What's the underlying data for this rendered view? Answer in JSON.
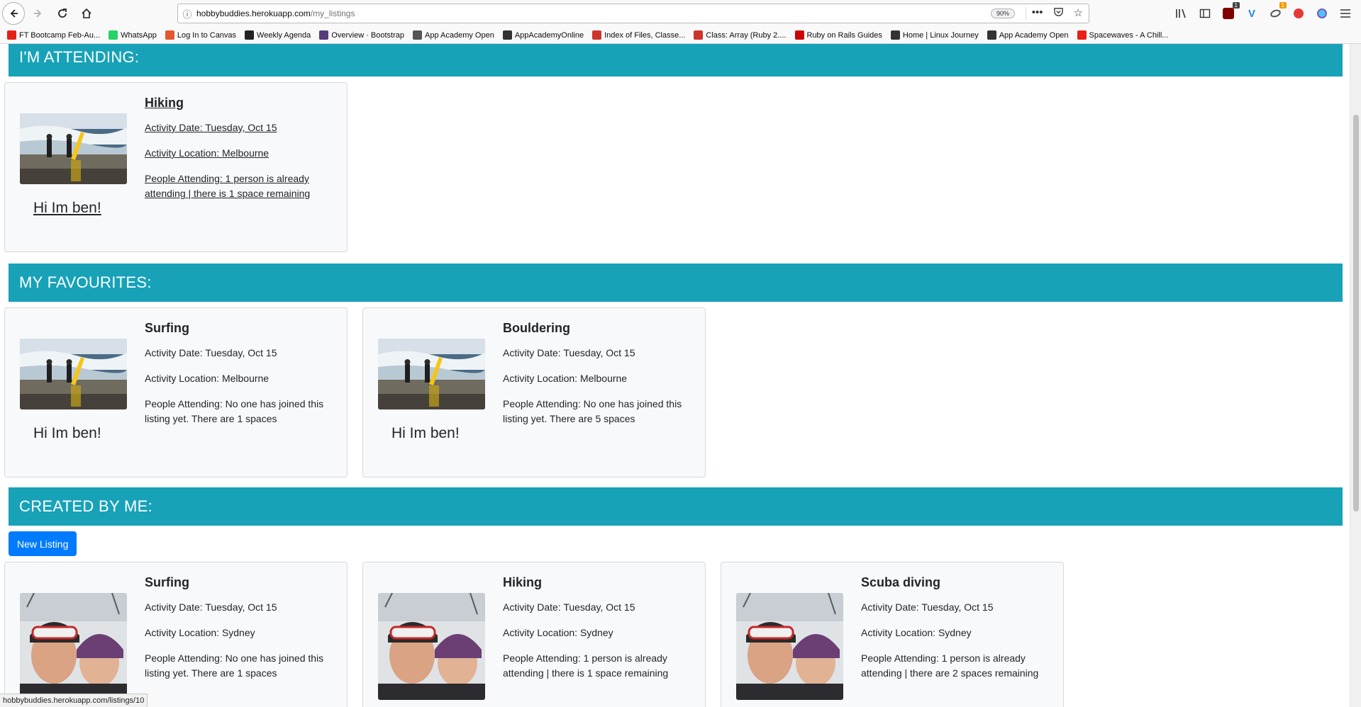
{
  "browser": {
    "url_host": "hobbybuddies.herokuapp.com",
    "url_path": "/my_listings",
    "zoom": "90%",
    "status_url": "hobbybuddies.herokuapp.com/listings/10",
    "bookmarks": [
      {
        "label": "FT Bootcamp Feb-Au...",
        "icon": "youtube-icon",
        "color": "#e62117"
      },
      {
        "label": "WhatsApp",
        "icon": "whatsapp-icon",
        "color": "#25d366"
      },
      {
        "label": "Log In to Canvas",
        "icon": "canvas-icon",
        "color": "#e4572e"
      },
      {
        "label": "Weekly Agenda",
        "icon": "notion-icon",
        "color": "#222222"
      },
      {
        "label": "Overview · Bootstrap",
        "icon": "bootstrap-icon",
        "color": "#563d7c"
      },
      {
        "label": "App Academy Open",
        "icon": "globe-icon",
        "color": "#555555"
      },
      {
        "label": "AppAcademyOnline",
        "icon": "appacademy-icon",
        "color": "#333333"
      },
      {
        "label": "Index of Files, Classe...",
        "icon": "ruby-icon",
        "color": "#cc342d"
      },
      {
        "label": "Class: Array (Ruby 2....",
        "icon": "ruby-icon",
        "color": "#cc342d"
      },
      {
        "label": "Ruby on Rails Guides",
        "icon": "rails-icon",
        "color": "#cc0000"
      },
      {
        "label": "Home | Linux Journey",
        "icon": "linux-icon",
        "color": "#333333"
      },
      {
        "label": "App Academy Open",
        "icon": "appacademy-icon",
        "color": "#333333"
      },
      {
        "label": "Spacewaves - A Chill...",
        "icon": "youtube-icon",
        "color": "#e62117"
      }
    ],
    "badges": {
      "ublock": "1",
      "extension": "1"
    }
  },
  "sections": {
    "attending": "I'M ATTENDING:",
    "favourites": "MY FAVOURITES:",
    "created": "CREATED BY ME:"
  },
  "new_listing_label": "New Listing",
  "attending": [
    {
      "title": "Hiking",
      "date": "Activity Date: Tuesday, Oct 15",
      "location": "Activity Location: Melbourne",
      "people": "People Attending: 1 person is already attending | there is 1 space remaining",
      "host": "Hi Im ben!"
    }
  ],
  "favourites": [
    {
      "title": "Surfing",
      "date": "Activity Date: Tuesday, Oct 15",
      "location": "Activity Location: Melbourne",
      "people": "People Attending: No one has joined this listing yet. There are 1 spaces",
      "host": "Hi Im ben!"
    },
    {
      "title": "Bouldering",
      "date": "Activity Date: Tuesday, Oct 15",
      "location": "Activity Location: Melbourne",
      "people": "People Attending: No one has joined this listing yet. There are 5 spaces",
      "host": "Hi Im ben!"
    }
  ],
  "created": [
    {
      "title": "Surfing",
      "date": "Activity Date: Tuesday, Oct 15",
      "location": "Activity Location: Sydney",
      "people": "People Attending: No one has joined this listing yet. There are 1 spaces"
    },
    {
      "title": "Hiking",
      "date": "Activity Date: Tuesday, Oct 15",
      "location": "Activity Location: Sydney",
      "people": "People Attending: 1 person is already attending | there is 1 space remaining"
    },
    {
      "title": "Scuba diving",
      "date": "Activity Date: Tuesday, Oct 15",
      "location": "Activity Location: Sydney",
      "people": "People Attending: 1 person is already attending | there are 2 spaces remaining"
    }
  ]
}
